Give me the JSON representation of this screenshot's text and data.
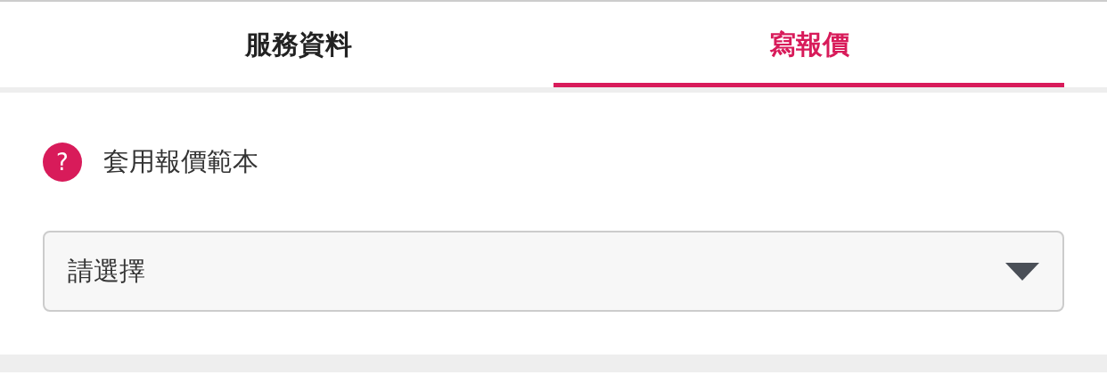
{
  "tabs": [
    {
      "label": "服務資料",
      "selected": false
    },
    {
      "label": "寫報價",
      "selected": true
    }
  ],
  "template": {
    "help_icon": "?",
    "label": "套用報價範本"
  },
  "select": {
    "placeholder": "請選擇"
  }
}
